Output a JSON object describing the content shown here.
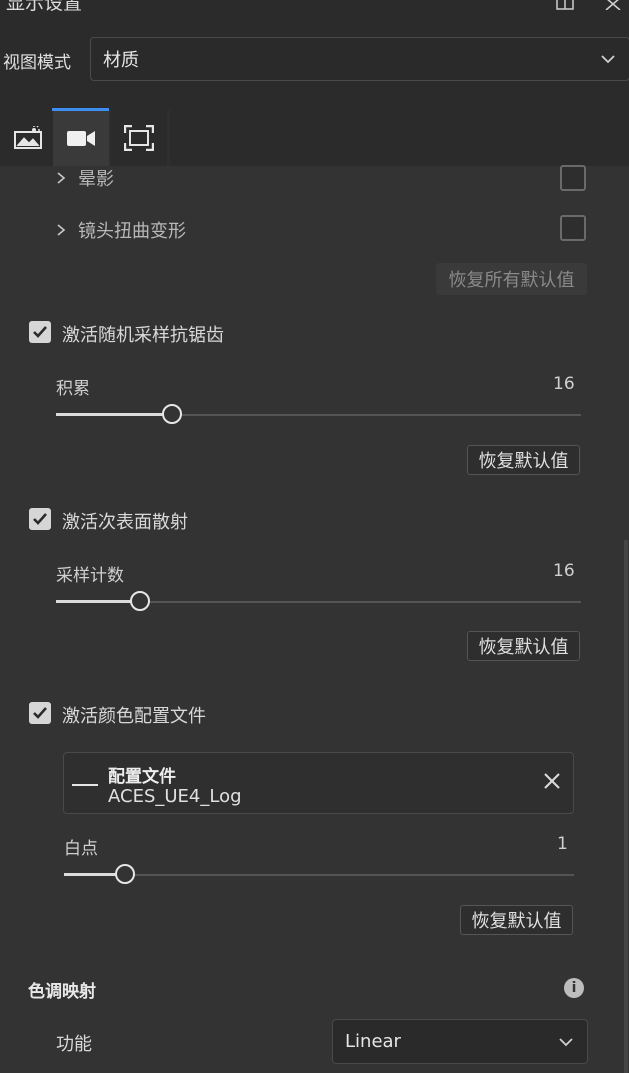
{
  "header": {
    "title": "显示设置"
  },
  "view_mode": {
    "label": "视图模式",
    "value": "材质"
  },
  "tabs": [
    {
      "icon": "image-adjust-icon",
      "active": false
    },
    {
      "icon": "camera-icon",
      "active": true
    },
    {
      "icon": "fullscreen-icon",
      "active": false
    }
  ],
  "collapsed_items": [
    {
      "label": "晕影"
    },
    {
      "label": "镜头扭曲变形"
    }
  ],
  "reset_all_label": "恢复所有默认值",
  "taa": {
    "label": "激活随机采样抗锯齿",
    "slider_label": "积累",
    "value": "16",
    "fill": 0.22,
    "reset_label": "恢复默认值"
  },
  "sss": {
    "label": "激活次表面散射",
    "slider_label": "采样计数",
    "value": "16",
    "fill": 0.16,
    "reset_label": "恢复默认值"
  },
  "color_profile": {
    "label": "激活颜色配置文件",
    "profile_title": "配置文件",
    "profile_value": "ACES_UE4_Log",
    "slider_label": "白点",
    "value": "1",
    "fill": 0.12,
    "reset_label": "恢复默认值"
  },
  "tone_mapping": {
    "title": "色调映射",
    "func_label": "功能",
    "func_value": "Linear"
  },
  "colors": {
    "accent": "#3e8ef2",
    "panel": "#333333",
    "header": "#2b2b2b"
  }
}
